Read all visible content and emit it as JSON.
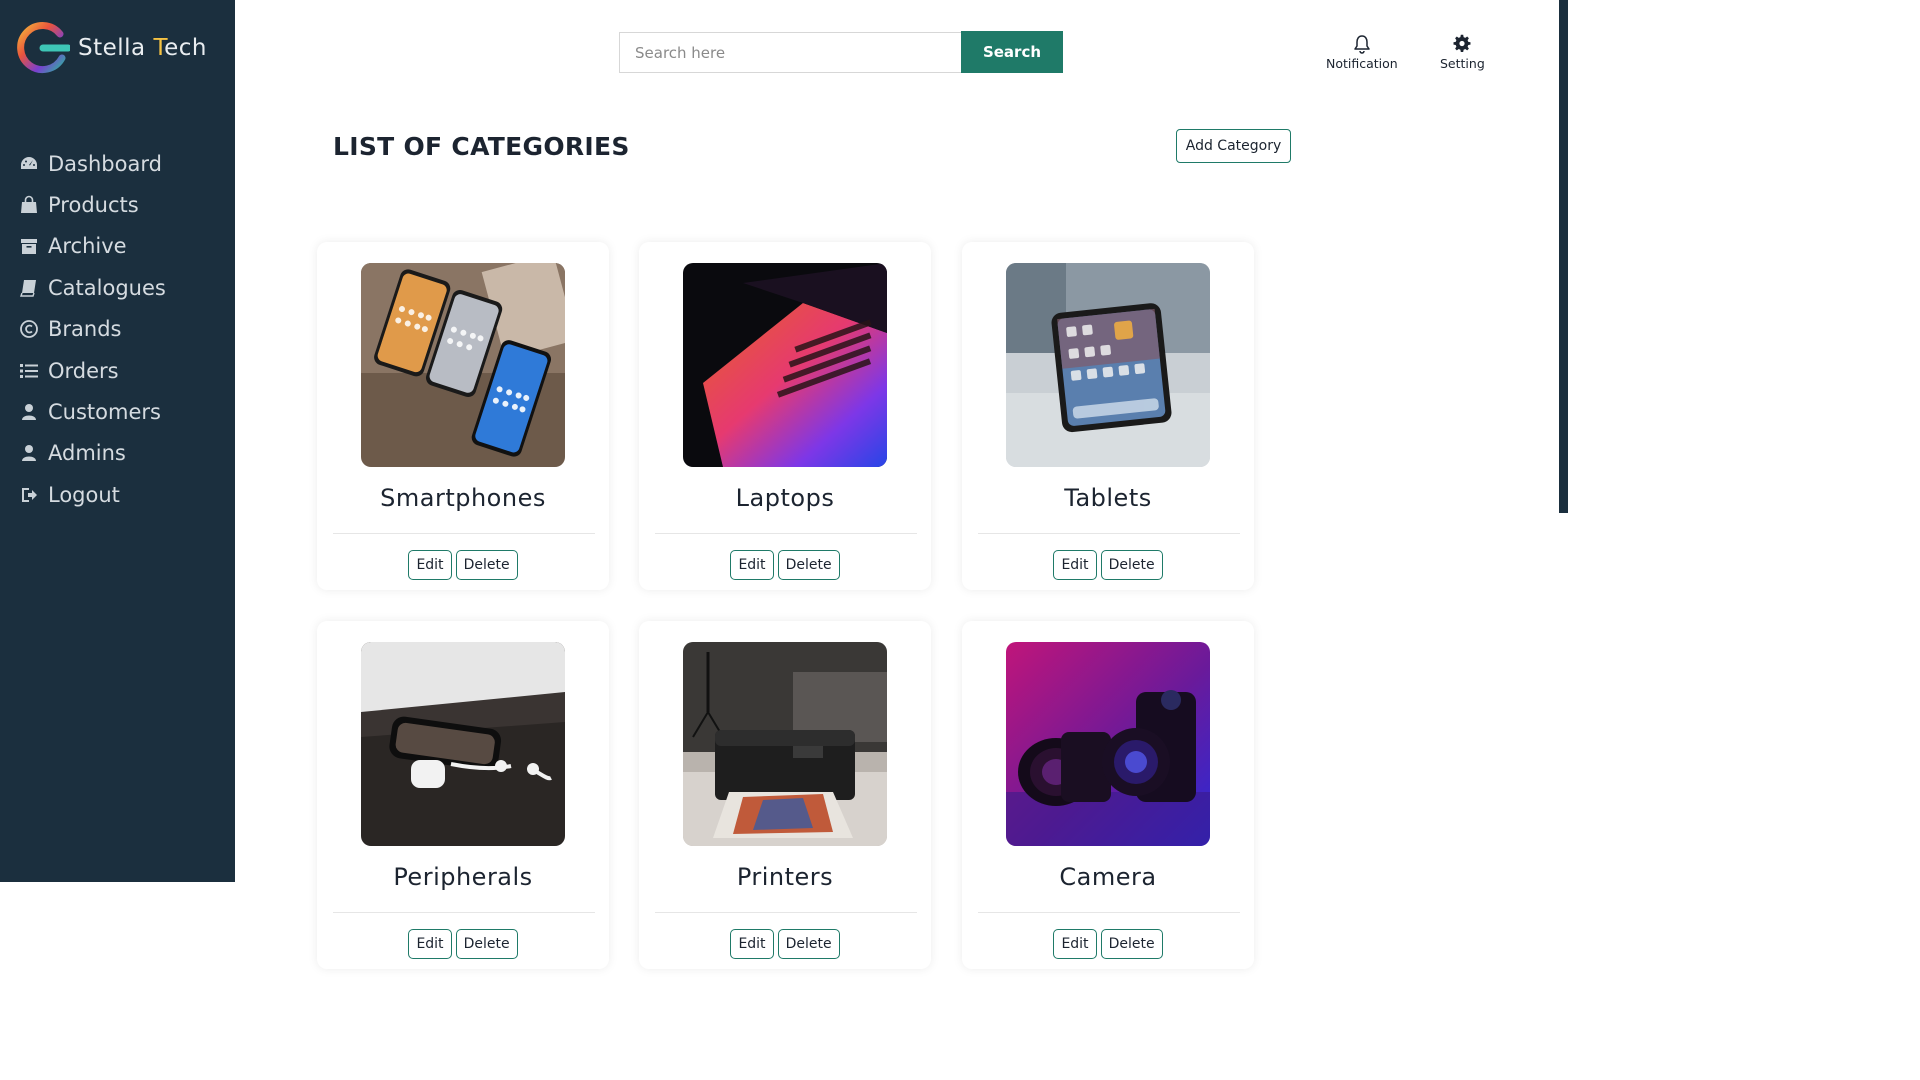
{
  "brand": {
    "name_part1": "Stella ",
    "name_part2": "T",
    "name_part3": "ech"
  },
  "sidebar": {
    "items": [
      {
        "label": "Dashboard",
        "icon": "dashboard-icon"
      },
      {
        "label": "Products",
        "icon": "shopping-bag-icon"
      },
      {
        "label": "Archive",
        "icon": "archive-icon"
      },
      {
        "label": "Catalogues",
        "icon": "book-icon"
      },
      {
        "label": "Brands",
        "icon": "copyright-icon"
      },
      {
        "label": "Orders",
        "icon": "list-icon"
      },
      {
        "label": "Customers",
        "icon": "user-icon"
      },
      {
        "label": "Admins",
        "icon": "user-icon"
      },
      {
        "label": "Logout",
        "icon": "sign-out-icon"
      }
    ]
  },
  "search": {
    "placeholder": "Search here",
    "button_label": "Search"
  },
  "header_actions": {
    "notification_label": "Notification",
    "setting_label": "Setting"
  },
  "main": {
    "title": "LIST OF CATEGORIES",
    "add_button_label": "Add Category",
    "categories": [
      {
        "name": "Smartphones",
        "edit_label": "Edit",
        "delete_label": "Delete"
      },
      {
        "name": "Laptops",
        "edit_label": "Edit",
        "delete_label": "Delete"
      },
      {
        "name": "Tablets",
        "edit_label": "Edit",
        "delete_label": "Delete"
      },
      {
        "name": "Peripherals",
        "edit_label": "Edit",
        "delete_label": "Delete"
      },
      {
        "name": "Printers",
        "edit_label": "Edit",
        "delete_label": "Delete"
      },
      {
        "name": "Camera",
        "edit_label": "Edit",
        "delete_label": "Delete"
      }
    ]
  },
  "colors": {
    "sidebar_bg": "#1b2f3e",
    "accent": "#1f7a68",
    "text_dark": "#1c2430"
  }
}
